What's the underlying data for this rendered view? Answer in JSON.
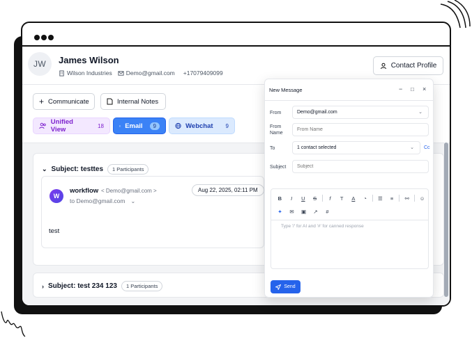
{
  "contact": {
    "initials": "JW",
    "name": "James Wilson",
    "company": "Wilson Industries",
    "email": "Demo@gmail.com",
    "phone": "+17079409099",
    "profile_button": "Contact Profile"
  },
  "actions": {
    "communicate": "Communicate",
    "internal_notes": "Internal Notes"
  },
  "tabs": {
    "unified": {
      "label": "Unified View",
      "count": "18"
    },
    "email": {
      "label": "Email",
      "count": "9"
    },
    "webchat": {
      "label": "Webchat",
      "count": "9"
    }
  },
  "threads": [
    {
      "subject": "Subject: testtes",
      "participants": "1 Participants",
      "message": {
        "avatar": "W",
        "sender": "workflow",
        "sender_email": "< Demo@gmail.com >",
        "to": "to Demo@gmail.com",
        "date": "Aug 22, 2025, 02:11 PM",
        "body": "test"
      }
    },
    {
      "subject": "Subject: test 234 123",
      "participants": "1 Participants"
    }
  ],
  "compose": {
    "title": "New Message",
    "from_label": "From",
    "from_value": "Demo@gmail.com",
    "from_name_label": "From Name",
    "from_name_placeholder": "From Name",
    "to_label": "To",
    "to_value": "1 contact selected",
    "cc_label": "Cc",
    "subject_label": "Subject",
    "subject_placeholder": "Subject",
    "editor_placeholder": "Type '/' for AI and '#' for canned response",
    "send_label": "Send"
  },
  "colors": {
    "accent": "#2563eb",
    "unified_bg": "#f3e8ff",
    "unified_text": "#7e22ce",
    "webchat_bg": "#dbeafe"
  }
}
